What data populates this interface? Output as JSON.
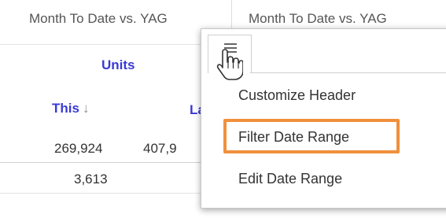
{
  "header": {
    "col1_title": "Month To Date vs. YAG",
    "col2_title": "Month To Date vs. YAG"
  },
  "subheader": {
    "group_label": "Units",
    "this_label": "This",
    "this_sort_arrow": "↓",
    "last_label": "La"
  },
  "rows": [
    {
      "this": "269,924",
      "last": "407,9"
    },
    {
      "this": "3,613"
    }
  ],
  "menu": {
    "icon": "hamburger-menu-icon",
    "items": [
      "Customize Header",
      "Filter Date Range",
      "Edit Date Range"
    ],
    "highlighted_item": "Filter Date Range",
    "highlight_color": "#f0903c"
  },
  "colors": {
    "header_link": "#3a3ad6"
  }
}
